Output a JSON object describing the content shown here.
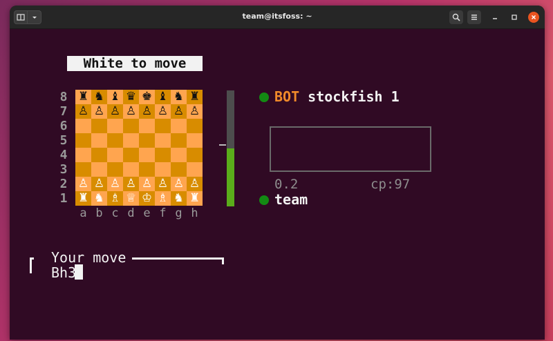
{
  "window": {
    "title": "team@itsfoss: ~",
    "new_tab_icon": "terminal-icon",
    "menu_icon": "chevron-down-icon",
    "search_icon": "search-icon",
    "hamburger_icon": "hamburger-icon",
    "minimize_icon": "minimize-icon",
    "maximize_icon": "maximize-icon",
    "close_icon": "close-icon",
    "accent_close": "#e95420",
    "terminal_bg": "#300a24"
  },
  "game": {
    "status": "White to move",
    "ranks": [
      "8",
      "7",
      "6",
      "5",
      "4",
      "3",
      "2",
      "1"
    ],
    "files": [
      "a",
      "b",
      "c",
      "d",
      "e",
      "f",
      "g",
      "h"
    ],
    "board": [
      [
        "♜",
        "♞",
        "♝",
        "♛",
        "♚",
        "♝",
        "♞",
        "♜"
      ],
      [
        "♙",
        "♙",
        "♙",
        "♙",
        "♙",
        "♙",
        "♙",
        "♙"
      ],
      [
        "",
        "",
        "",
        "",
        "",
        "",
        "",
        ""
      ],
      [
        "",
        "",
        "",
        "",
        "",
        "",
        "",
        ""
      ],
      [
        "",
        "",
        "",
        "",
        "",
        "",
        "",
        ""
      ],
      [
        "",
        "",
        "",
        "",
        "",
        "",
        "",
        ""
      ],
      [
        "♙",
        "♙",
        "♙",
        "♙",
        "♙",
        "♙",
        "♙",
        "♙"
      ],
      [
        "♜",
        "♞",
        "♗",
        "♕",
        "♔",
        "♗",
        "♞",
        "♜"
      ]
    ],
    "piece_colors": [
      [
        "b",
        "b",
        "b",
        "b",
        "b",
        "b",
        "b",
        "b"
      ],
      [
        "b",
        "b",
        "b",
        "b",
        "b",
        "b",
        "b",
        "b"
      ],
      [
        "",
        "",
        "",
        "",
        "",
        "",
        "",
        ""
      ],
      [
        "",
        "",
        "",
        "",
        "",
        "",
        "",
        ""
      ],
      [
        "",
        "",
        "",
        "",
        "",
        "",
        "",
        ""
      ],
      [
        "",
        "",
        "",
        "",
        "",
        "",
        "",
        ""
      ],
      [
        "w",
        "w",
        "w",
        "w",
        "w",
        "w",
        "w",
        "w"
      ],
      [
        "w",
        "w",
        "w",
        "w",
        "w",
        "w",
        "w",
        "w"
      ]
    ],
    "light_square_color": "#ffa54f",
    "dark_square_color": "#d88c00",
    "eval_bar_white_fraction": 0.5
  },
  "players": {
    "bot": {
      "tag": "BOT",
      "name": "stockfish 1",
      "indicator_color": "#138a13"
    },
    "user": {
      "name": "team",
      "indicator_color": "#138a13"
    }
  },
  "evaluation": {
    "value": "0.2",
    "centipawns": "cp:97"
  },
  "move_prompt": {
    "title": "Your move",
    "value": "Bh3"
  }
}
